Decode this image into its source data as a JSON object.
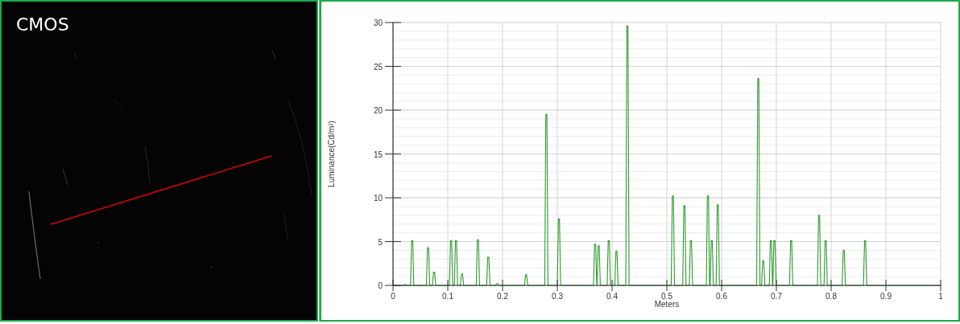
{
  "image_panel": {
    "label": "CMOS",
    "kind": "picture"
  },
  "chart": {
    "chart_data": {
      "type": "line",
      "xlabel": "Meters",
      "ylabel": "Luminance(Cd/m²)",
      "x": [
        0,
        0.019,
        0.021,
        0.023,
        0.025,
        0.032,
        0.034,
        0.036,
        0.038,
        0.061,
        0.063,
        0.065,
        0.067,
        0.072,
        0.074,
        0.076,
        0.078,
        0.103,
        0.105,
        0.107,
        0.109,
        0.112,
        0.114,
        0.116,
        0.118,
        0.123,
        0.125,
        0.127,
        0.129,
        0.152,
        0.154,
        0.156,
        0.158,
        0.171,
        0.173,
        0.175,
        0.177,
        0.187,
        0.189,
        0.191,
        0.193,
        0.24,
        0.242,
        0.244,
        0.246,
        0.277,
        0.279,
        0.281,
        0.283,
        0.3,
        0.302,
        0.304,
        0.306,
        0.366,
        0.368,
        0.37,
        0.372,
        0.3725,
        0.3745,
        0.3765,
        0.3785,
        0.391,
        0.393,
        0.395,
        0.397,
        0.405,
        0.407,
        0.409,
        0.411,
        0.425,
        0.427,
        0.429,
        0.431,
        0.508,
        0.51,
        0.512,
        0.514,
        0.529,
        0.531,
        0.533,
        0.535,
        0.541,
        0.543,
        0.545,
        0.547,
        0.572,
        0.574,
        0.576,
        0.578,
        0.579,
        0.581,
        0.583,
        0.585,
        0.59,
        0.592,
        0.594,
        0.596,
        0.664,
        0.666,
        0.668,
        0.67,
        0.673,
        0.675,
        0.677,
        0.679,
        0.687,
        0.689,
        0.691,
        0.693,
        0.6935,
        0.6955,
        0.6975,
        0.6995,
        0.724,
        0.726,
        0.728,
        0.73,
        0.775,
        0.777,
        0.779,
        0.781,
        0.787,
        0.789,
        0.791,
        0.793,
        0.82,
        0.822,
        0.824,
        0.826,
        0.859,
        0.861,
        0.863,
        0.865,
        1
      ],
      "series": [
        {
          "color": "#2e9a2e",
          "values": [
            0,
            0,
            0.1,
            0.1,
            0,
            0,
            5.1,
            5.1,
            0,
            0,
            4.3,
            4.3,
            0,
            0,
            1.5,
            1.5,
            0,
            0,
            5.1,
            5.1,
            0,
            0,
            5.1,
            5.1,
            0,
            0,
            1.3,
            1.3,
            0,
            0,
            5.2,
            5.2,
            0,
            0,
            3.2,
            3.2,
            0,
            0,
            0.2,
            0.2,
            0,
            0,
            1.2,
            1.2,
            0,
            0,
            19.5,
            19.5,
            0,
            0,
            7.6,
            7.6,
            0,
            0,
            4.7,
            4.7,
            0,
            0,
            4.5,
            4.5,
            0,
            0,
            5.1,
            5.1,
            0,
            0,
            3.9,
            3.9,
            0,
            0,
            29.6,
            29.6,
            0,
            0,
            10.2,
            10.2,
            0,
            0,
            9.1,
            9.1,
            0,
            0,
            5.1,
            5.1,
            0,
            0,
            10.2,
            10.2,
            0,
            0,
            5.1,
            5.1,
            0,
            0,
            9.2,
            9.2,
            0,
            0,
            23.6,
            23.6,
            0,
            0,
            2.8,
            2.8,
            0,
            0,
            5.1,
            5.1,
            0,
            0,
            5.1,
            5.1,
            0,
            0,
            5.1,
            5.1,
            0,
            0,
            8,
            8,
            0,
            0,
            5.1,
            5.1,
            0,
            0,
            4,
            4,
            0,
            0,
            5.1,
            5.1,
            0,
            0
          ]
        }
      ],
      "xlim": [
        0,
        1
      ],
      "ylim": [
        0,
        30
      ],
      "xticks": [
        0,
        0.1,
        0.2,
        0.3,
        0.4,
        0.5,
        0.6,
        0.7,
        0.8,
        0.9,
        1
      ],
      "yticks": [
        0,
        5,
        10,
        15,
        20,
        25,
        30
      ],
      "grid": true
    }
  }
}
